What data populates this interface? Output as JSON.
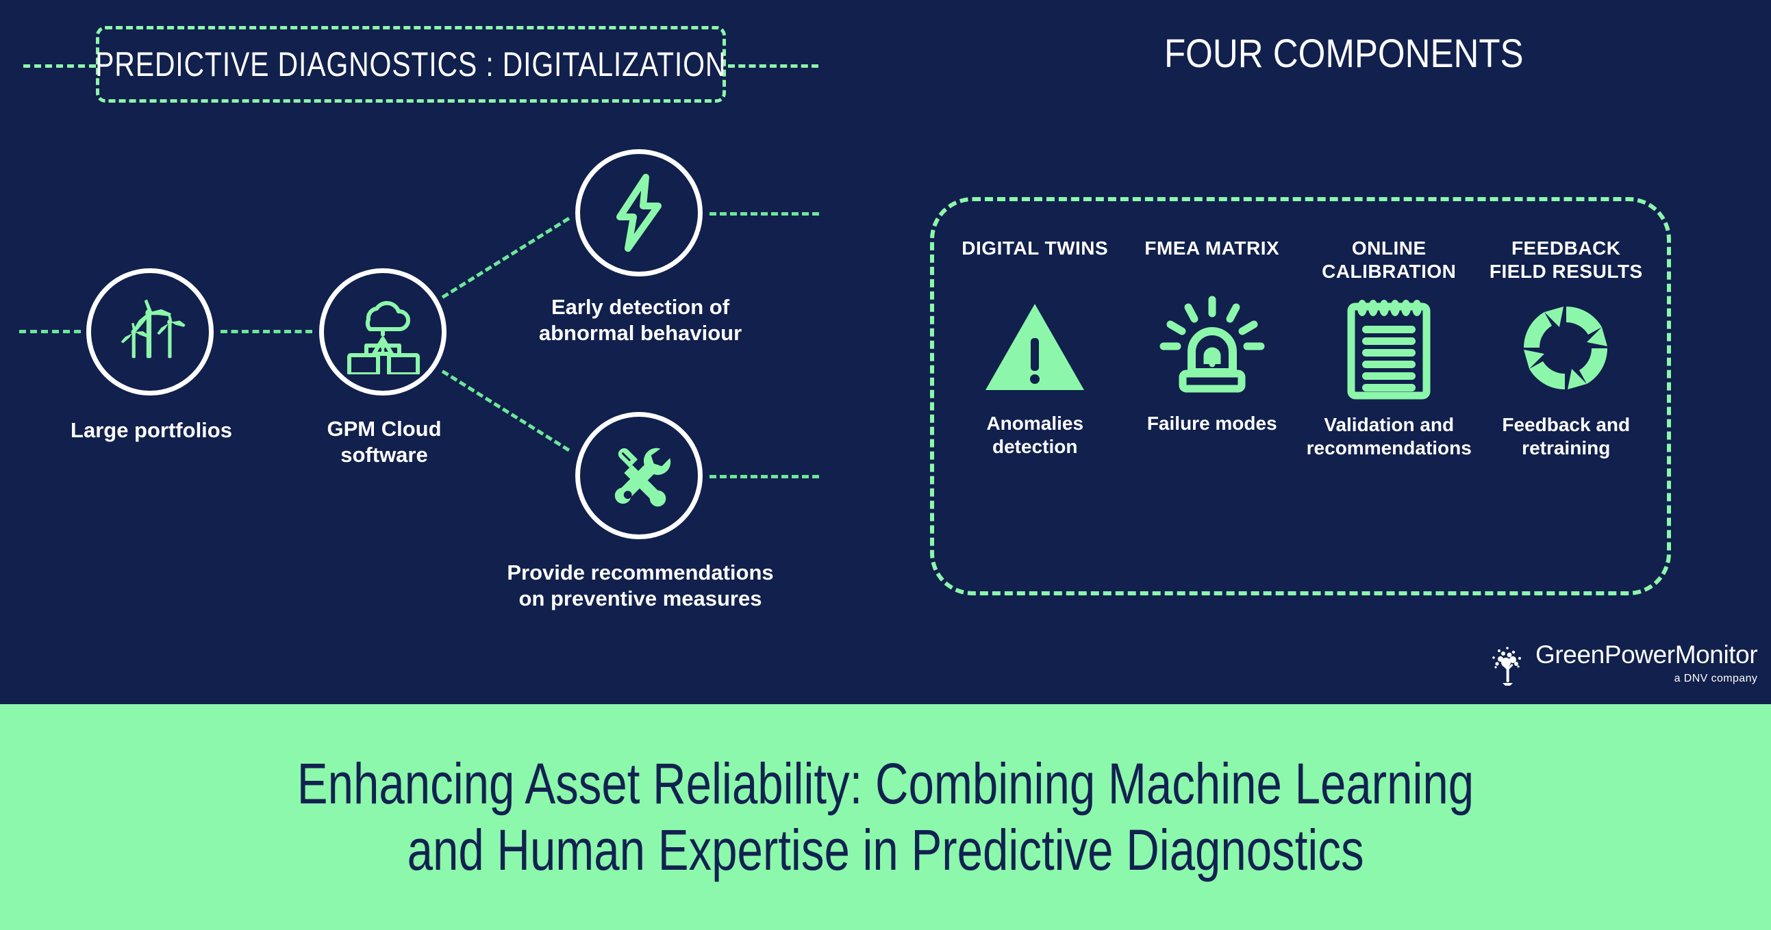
{
  "header": {
    "left_title": "PREDICTIVE DIAGNOSTICS : DIGITALIZATION",
    "right_title": "FOUR COMPONENTS"
  },
  "flow": {
    "nodes": [
      {
        "id": "large-portfolios",
        "icon": "wind-turbines-icon",
        "label": "Large portfolios"
      },
      {
        "id": "gpm-cloud-software",
        "icon": "cloud-monitors-icon",
        "label": "GPM Cloud\nsoftware"
      },
      {
        "id": "early-detection",
        "icon": "lightning-bolt-icon",
        "label": "Early detection of\nabnormal behaviour"
      },
      {
        "id": "preventive-measures",
        "icon": "tools-icon",
        "label": "Provide recommendations\non preventive measures"
      }
    ],
    "labels": {
      "portfolio": "Large portfolios",
      "cloud_line1": "GPM Cloud",
      "cloud_line2": "software",
      "bolt_line1": "Early detection of",
      "bolt_line2": "abnormal behaviour",
      "tools_line1": "Provide recommendations",
      "tools_line2": "on preventive measures"
    }
  },
  "components": [
    {
      "title": "DIGITAL TWINS",
      "icon": "warning-triangle-icon",
      "caption_line1": "Anomalies",
      "caption_line2": "detection"
    },
    {
      "title": "FMEA MATRIX",
      "icon": "alarm-siren-icon",
      "caption_line1": "Failure modes",
      "caption_line2": ""
    },
    {
      "title_line1": "ONLINE",
      "title_line2": "CALIBRATION",
      "icon": "notepad-icon",
      "caption_line1": "Validation and",
      "caption_line2": "recommendations"
    },
    {
      "title_line1": "FEEDBACK",
      "title_line2": "FIELD RESULTS",
      "icon": "cycle-arrows-icon",
      "caption_line1": "Feedback and",
      "caption_line2": "retraining"
    }
  ],
  "components_flat": {
    "c1_title": "DIGITAL TWINS",
    "c1_cap1": "Anomalies",
    "c1_cap2": "detection",
    "c2_title": "FMEA MATRIX",
    "c2_cap1": "Failure modes",
    "c3_title1": "ONLINE",
    "c3_title2": "CALIBRATION",
    "c3_cap1": "Validation and",
    "c3_cap2": "recommendations",
    "c4_title1": "FEEDBACK",
    "c4_title2": "FIELD RESULTS",
    "c4_cap1": "Feedback and",
    "c4_cap2": "retraining"
  },
  "logo": {
    "name": "GreenPowerMonitor",
    "tagline": "a DNV company",
    "mark": "tree-particles-icon"
  },
  "banner": {
    "line1": "Enhancing Asset Reliability: Combining Machine Learning",
    "line2": "and Human Expertise in Predictive Diagnostics"
  },
  "colors": {
    "background_navy": "#11204c",
    "accent_green": "#8cf7ab",
    "banner_green": "#8cf8ab",
    "banner_text_navy": "#122250",
    "white": "#ffffff"
  }
}
